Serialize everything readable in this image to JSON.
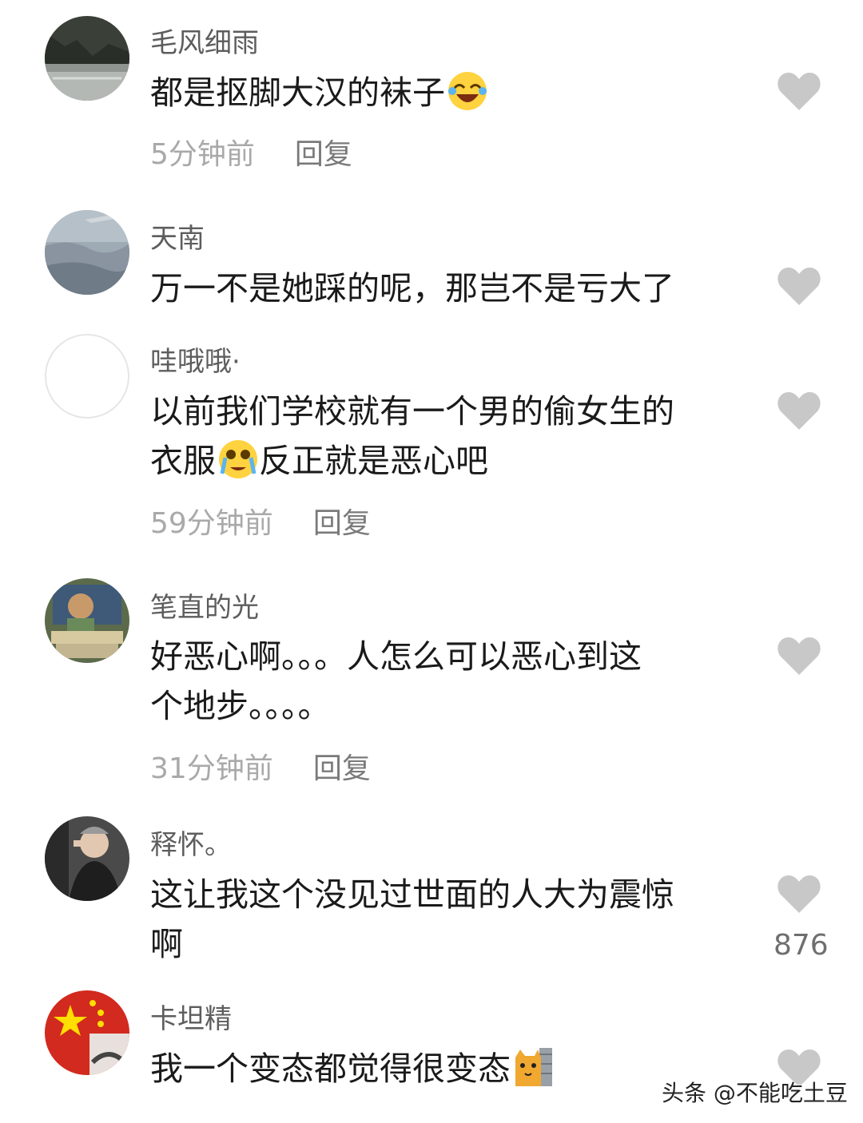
{
  "comments": [
    {
      "username": "毛风细雨",
      "text": "都是抠脚大汉的袜子",
      "emoji": "laughing-crying-emoji",
      "time": "5分钟前",
      "reply": "回复"
    },
    {
      "username": "天南",
      "text": "万一不是她踩的呢，那岂不是亏大了"
    },
    {
      "username": "哇哦哦·",
      "line1": "以前我们学校就有一个男的偷女生的",
      "line2": "衣服",
      "emoji": "crying-emoji",
      "line2b": "反正就是恶心吧",
      "time": "59分钟前",
      "reply": "回复"
    },
    {
      "username": "笔直的光",
      "line1": "好恶心啊。。。人怎么可以恶心到这",
      "line2": "个地步。。。。",
      "time": "31分钟前",
      "reply": "回复"
    },
    {
      "username": "释怀。",
      "line1": "这让我这个没见过世面的人大为震惊",
      "line2": "啊",
      "likes": "876"
    },
    {
      "username": "卡坦精",
      "text": "我一个变态都觉得很变态",
      "emoji": "cat-peeking-emoji"
    }
  ],
  "watermark": "头条 @不能吃土豆",
  "colors": {
    "like": "#c8c8c8",
    "username": "#5d5d5d",
    "meta": "#a9a9a9"
  }
}
